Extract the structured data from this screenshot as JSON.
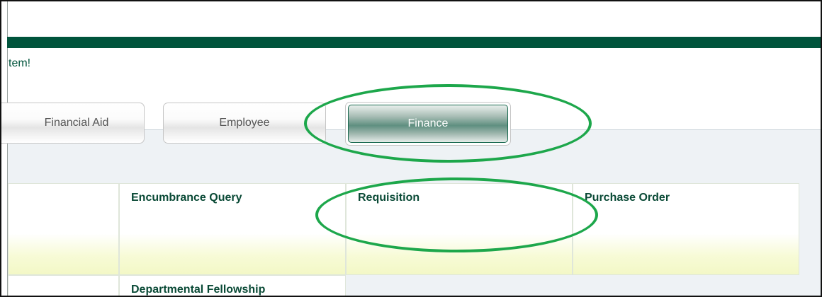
{
  "header": {
    "welcome_text": "tem!"
  },
  "tabs": [
    {
      "label": "Financial Aid",
      "selected": false
    },
    {
      "label": "Employee",
      "selected": false
    },
    {
      "label": "Finance",
      "selected": true
    }
  ],
  "cards": [
    {
      "title": ""
    },
    {
      "title": "Encumbrance Query"
    },
    {
      "title": "Requisition"
    },
    {
      "title": "Purchase Order"
    },
    {
      "title": "Departmental Fellowship"
    }
  ],
  "colors": {
    "brand_green": "#00543c",
    "annotation_green": "#1da74b"
  }
}
